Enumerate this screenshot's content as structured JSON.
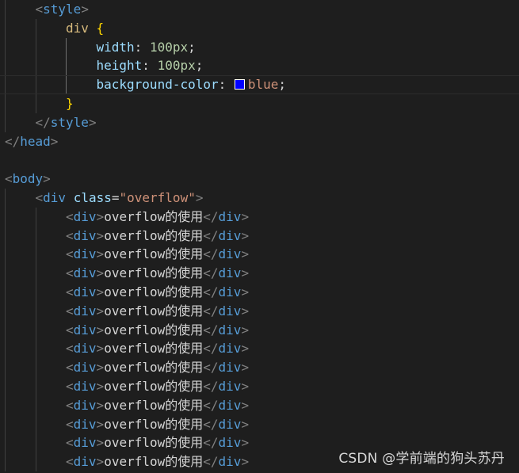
{
  "editor": {
    "lines": [
      {
        "indent": 1,
        "tokens": [
          [
            "punct",
            "<"
          ],
          [
            "tag",
            "style"
          ],
          [
            "punct",
            ">"
          ]
        ]
      },
      {
        "indent": 2,
        "tokens": [
          [
            "selector",
            "div"
          ],
          [
            "text",
            " "
          ],
          [
            "brace",
            "{"
          ]
        ]
      },
      {
        "indent": 3,
        "tokens": [
          [
            "prop",
            "width"
          ],
          [
            "text",
            ": "
          ],
          [
            "num",
            "100px"
          ],
          [
            "text",
            ";"
          ]
        ]
      },
      {
        "indent": 3,
        "tokens": [
          [
            "prop",
            "height"
          ],
          [
            "text",
            ": "
          ],
          [
            "num",
            "100px"
          ],
          [
            "text",
            ";"
          ]
        ]
      },
      {
        "indent": 3,
        "tokens": [
          [
            "prop",
            "background-color"
          ],
          [
            "text",
            ": "
          ],
          [
            "swatch",
            ""
          ],
          [
            "val",
            "blue"
          ],
          [
            "text",
            ";"
          ]
        ],
        "current": true
      },
      {
        "indent": 2,
        "tokens": [
          [
            "brace",
            "}"
          ]
        ]
      },
      {
        "indent": 1,
        "tokens": [
          [
            "punct",
            "</"
          ],
          [
            "tag",
            "style"
          ],
          [
            "punct",
            ">"
          ]
        ]
      },
      {
        "indent": 0,
        "tokens": [
          [
            "punct",
            "</"
          ],
          [
            "tag",
            "head"
          ],
          [
            "punct",
            ">"
          ]
        ]
      },
      {
        "indent": 0,
        "tokens": []
      },
      {
        "indent": 0,
        "tokens": [
          [
            "punct",
            "<"
          ],
          [
            "tag",
            "body"
          ],
          [
            "punct",
            ">"
          ]
        ]
      },
      {
        "indent": 1,
        "tokens": [
          [
            "punct",
            "<"
          ],
          [
            "tag",
            "div"
          ],
          [
            "text",
            " "
          ],
          [
            "attr",
            "class"
          ],
          [
            "text",
            "="
          ],
          [
            "str",
            "\"overflow\""
          ],
          [
            "punct",
            ">"
          ]
        ]
      },
      {
        "indent": 2,
        "tokens": [
          [
            "punct",
            "<"
          ],
          [
            "tag",
            "div"
          ],
          [
            "punct",
            ">"
          ],
          [
            "text",
            "overflow的使用"
          ],
          [
            "punct",
            "</"
          ],
          [
            "tag",
            "div"
          ],
          [
            "punct",
            ">"
          ]
        ]
      },
      {
        "indent": 2,
        "tokens": [
          [
            "punct",
            "<"
          ],
          [
            "tag",
            "div"
          ],
          [
            "punct",
            ">"
          ],
          [
            "text",
            "overflow的使用"
          ],
          [
            "punct",
            "</"
          ],
          [
            "tag",
            "div"
          ],
          [
            "punct",
            ">"
          ]
        ]
      },
      {
        "indent": 2,
        "tokens": [
          [
            "punct",
            "<"
          ],
          [
            "tag",
            "div"
          ],
          [
            "punct",
            ">"
          ],
          [
            "text",
            "overflow的使用"
          ],
          [
            "punct",
            "</"
          ],
          [
            "tag",
            "div"
          ],
          [
            "punct",
            ">"
          ]
        ]
      },
      {
        "indent": 2,
        "tokens": [
          [
            "punct",
            "<"
          ],
          [
            "tag",
            "div"
          ],
          [
            "punct",
            ">"
          ],
          [
            "text",
            "overflow的使用"
          ],
          [
            "punct",
            "</"
          ],
          [
            "tag",
            "div"
          ],
          [
            "punct",
            ">"
          ]
        ]
      },
      {
        "indent": 2,
        "tokens": [
          [
            "punct",
            "<"
          ],
          [
            "tag",
            "div"
          ],
          [
            "punct",
            ">"
          ],
          [
            "text",
            "overflow的使用"
          ],
          [
            "punct",
            "</"
          ],
          [
            "tag",
            "div"
          ],
          [
            "punct",
            ">"
          ]
        ]
      },
      {
        "indent": 2,
        "tokens": [
          [
            "punct",
            "<"
          ],
          [
            "tag",
            "div"
          ],
          [
            "punct",
            ">"
          ],
          [
            "text",
            "overflow的使用"
          ],
          [
            "punct",
            "</"
          ],
          [
            "tag",
            "div"
          ],
          [
            "punct",
            ">"
          ]
        ]
      },
      {
        "indent": 2,
        "tokens": [
          [
            "punct",
            "<"
          ],
          [
            "tag",
            "div"
          ],
          [
            "punct",
            ">"
          ],
          [
            "text",
            "overflow的使用"
          ],
          [
            "punct",
            "</"
          ],
          [
            "tag",
            "div"
          ],
          [
            "punct",
            ">"
          ]
        ]
      },
      {
        "indent": 2,
        "tokens": [
          [
            "punct",
            "<"
          ],
          [
            "tag",
            "div"
          ],
          [
            "punct",
            ">"
          ],
          [
            "text",
            "overflow的使用"
          ],
          [
            "punct",
            "</"
          ],
          [
            "tag",
            "div"
          ],
          [
            "punct",
            ">"
          ]
        ]
      },
      {
        "indent": 2,
        "tokens": [
          [
            "punct",
            "<"
          ],
          [
            "tag",
            "div"
          ],
          [
            "punct",
            ">"
          ],
          [
            "text",
            "overflow的使用"
          ],
          [
            "punct",
            "</"
          ],
          [
            "tag",
            "div"
          ],
          [
            "punct",
            ">"
          ]
        ]
      },
      {
        "indent": 2,
        "tokens": [
          [
            "punct",
            "<"
          ],
          [
            "tag",
            "div"
          ],
          [
            "punct",
            ">"
          ],
          [
            "text",
            "overflow的使用"
          ],
          [
            "punct",
            "</"
          ],
          [
            "tag",
            "div"
          ],
          [
            "punct",
            ">"
          ]
        ]
      },
      {
        "indent": 2,
        "tokens": [
          [
            "punct",
            "<"
          ],
          [
            "tag",
            "div"
          ],
          [
            "punct",
            ">"
          ],
          [
            "text",
            "overflow的使用"
          ],
          [
            "punct",
            "</"
          ],
          [
            "tag",
            "div"
          ],
          [
            "punct",
            ">"
          ]
        ]
      },
      {
        "indent": 2,
        "tokens": [
          [
            "punct",
            "<"
          ],
          [
            "tag",
            "div"
          ],
          [
            "punct",
            ">"
          ],
          [
            "text",
            "overflow的使用"
          ],
          [
            "punct",
            "</"
          ],
          [
            "tag",
            "div"
          ],
          [
            "punct",
            ">"
          ]
        ]
      },
      {
        "indent": 2,
        "tokens": [
          [
            "punct",
            "<"
          ],
          [
            "tag",
            "div"
          ],
          [
            "punct",
            ">"
          ],
          [
            "text",
            "overflow的使用"
          ],
          [
            "punct",
            "</"
          ],
          [
            "tag",
            "div"
          ],
          [
            "punct",
            ">"
          ]
        ]
      },
      {
        "indent": 2,
        "tokens": [
          [
            "punct",
            "<"
          ],
          [
            "tag",
            "div"
          ],
          [
            "punct",
            ">"
          ],
          [
            "text",
            "overflow的使用"
          ],
          [
            "punct",
            "</"
          ],
          [
            "tag",
            "div"
          ],
          [
            "punct",
            ">"
          ]
        ]
      }
    ],
    "swatch_color": "#0000ff"
  },
  "watermark": {
    "text": "CSDN @学前端的狗头苏丹"
  }
}
